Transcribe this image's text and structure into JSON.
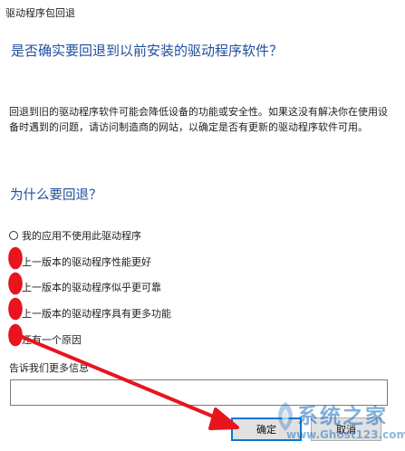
{
  "window": {
    "title": "驱动程序包回退"
  },
  "heading": "是否确实要回退到以前安装的驱动程序软件？",
  "description": "回退到旧的驱动程序软件可能会降低设备的功能或安全性。如果这没有解决你在使用设备时遇到的问题，请访问制造商的网站，以确定是否有更新的驱动程序软件可用。",
  "why_heading": "为什么要回退？",
  "options": [
    {
      "label": "我的应用不使用此驱动程序"
    },
    {
      "label": "上一版本的驱动程序性能更好"
    },
    {
      "label": "上一版本的驱动程序似乎更可靠"
    },
    {
      "label": "上一版本的驱动程序具有更多功能"
    },
    {
      "label": "还有一个原因"
    }
  ],
  "more_info": {
    "label": "告诉我们更多信息",
    "value": "",
    "placeholder": ""
  },
  "buttons": {
    "ok": "确定",
    "cancel": "取消"
  },
  "annotation": {
    "color": "#e8141e"
  },
  "watermark": {
    "text_cn": "系统之家",
    "text_en": "www.Ghost123.com"
  }
}
